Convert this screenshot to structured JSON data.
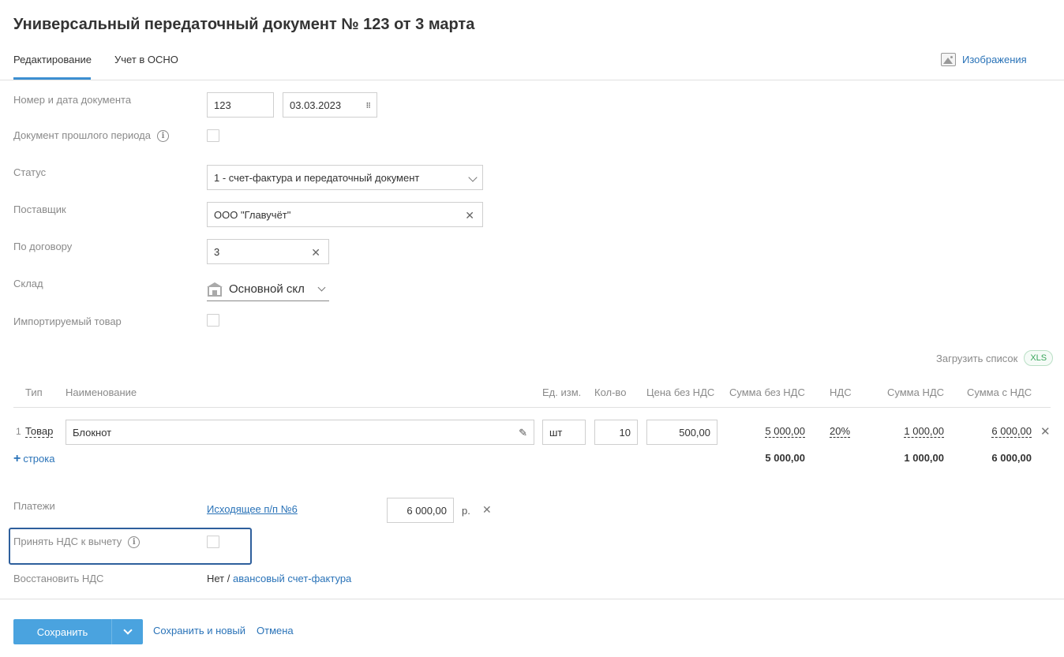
{
  "page": {
    "title": "Универсальный передаточный документ № 123 от 3 марта",
    "tabs": [
      {
        "label": "Редактирование",
        "active": true
      },
      {
        "label": "Учет в ОСНО",
        "active": false
      }
    ],
    "images_link": "Изображения"
  },
  "form": {
    "doc_number": {
      "label": "Номер и дата документа",
      "number": "123",
      "date": "03.03.2023"
    },
    "past_period": {
      "label": "Документ прошлого периода",
      "checked": false
    },
    "status": {
      "label": "Статус",
      "value": "1 - счет-фактура и передаточный документ"
    },
    "supplier": {
      "label": "Поставщик",
      "value": "ООО \"Главучёт\""
    },
    "contract": {
      "label": "По договору",
      "value": "3"
    },
    "warehouse": {
      "label": "Склад",
      "value": "Основной скл"
    },
    "imported": {
      "label": "Импортируемый товар",
      "checked": false
    }
  },
  "table": {
    "load_list": "Загрузить список",
    "xls_badge": "XLS",
    "headers": [
      "Тип",
      "Наименование",
      "Ед. изм.",
      "Кол-во",
      "Цена без НДС",
      "Сумма без НДС",
      "НДС",
      "Сумма НДС",
      "Сумма с НДС"
    ],
    "rows": [
      {
        "num": "1",
        "type": "Товар",
        "name": "Блокнот",
        "unit": "шт",
        "qty": "10",
        "price": "500,00",
        "sum_no_vat": "5 000,00",
        "vat": "20%",
        "vat_sum": "1 000,00",
        "sum_with_vat": "6 000,00"
      }
    ],
    "add_row": "строка",
    "totals": {
      "sum_no_vat": "5 000,00",
      "vat_sum": "1 000,00",
      "sum_with_vat": "6 000,00"
    }
  },
  "payments": {
    "label": "Платежи",
    "link": "Исходящее п/п №6",
    "amount": "6 000,00",
    "currency": "р."
  },
  "accept_vat": {
    "label": "Принять НДС к вычету",
    "checked": false
  },
  "restore_vat": {
    "label": "Восстановить НДС",
    "value": "Нет /",
    "link": "авансовый счет-фактура"
  },
  "footer": {
    "save": "Сохранить",
    "save_and_new": "Сохранить и новый",
    "cancel": "Отмена"
  },
  "colors": {
    "accent": "#4aa3df",
    "link": "#2a73b8",
    "focus": "#2e5f9c"
  }
}
